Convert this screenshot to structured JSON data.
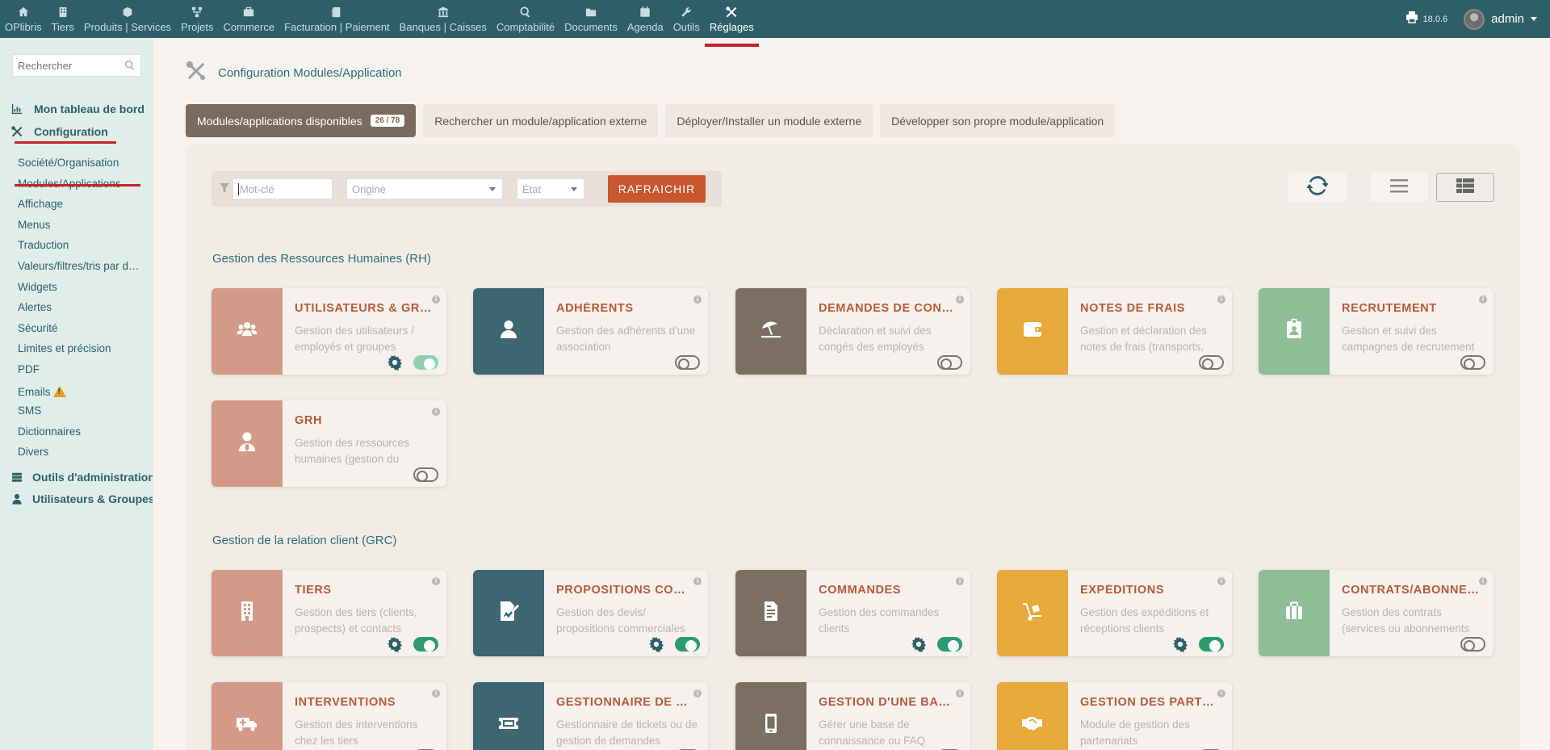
{
  "topnav": {
    "items": [
      {
        "label": "OPlibris",
        "icon": "home-icon"
      },
      {
        "label": "Tiers",
        "icon": "building-icon"
      },
      {
        "label": "Produits | Services",
        "icon": "cube-icon"
      },
      {
        "label": "Projets",
        "icon": "project-icon"
      },
      {
        "label": "Commerce",
        "icon": "briefcase-icon"
      },
      {
        "label": "Facturation | Paiement",
        "icon": "invoice-icon"
      },
      {
        "label": "Banques | Caisses",
        "icon": "bank-icon"
      },
      {
        "label": "Comptabilité",
        "icon": "search-dollar-icon"
      },
      {
        "label": "Documents",
        "icon": "folder-icon"
      },
      {
        "label": "Agenda",
        "icon": "calendar-icon"
      },
      {
        "label": "Outils",
        "icon": "wrench-icon"
      },
      {
        "label": "Réglages",
        "icon": "tools-icon",
        "active": true
      }
    ],
    "version": "18.0.6",
    "user": "admin"
  },
  "sidebar": {
    "search_placeholder": "Rechercher",
    "main_items": [
      {
        "label": "Mon tableau de bord",
        "icon": "chart-icon"
      },
      {
        "label": "Configuration",
        "icon": "tools-icon"
      },
      {
        "label": "Outils d'administration",
        "icon": "server-icon"
      },
      {
        "label": "Utilisateurs & Groupes",
        "icon": "user-icon"
      }
    ],
    "sub_items": [
      "Société/Organisation",
      "Modules/Applications",
      "Affichage",
      "Menus",
      "Traduction",
      "Valeurs/filtres/tris par défaut",
      "Widgets",
      "Alertes",
      "Sécurité",
      "Limites et précision",
      "PDF",
      "Emails",
      "SMS",
      "Dictionnaires",
      "Divers"
    ]
  },
  "page": {
    "title": "Configuration Modules/Application"
  },
  "tabs": [
    {
      "label": "Modules/applications disponibles",
      "badge": "26 / 78"
    },
    {
      "label": "Rechercher un module/application externe"
    },
    {
      "label": "Déployer/Installer un module externe"
    },
    {
      "label": "Développer son propre module/application"
    }
  ],
  "filters": {
    "keyword_placeholder": "Mot-clé",
    "origin_placeholder": "Origine",
    "state_placeholder": "État",
    "refresh_label": "RAFRAICHIR"
  },
  "sections": [
    {
      "title": "Gestion des Ressources Humaines (RH)",
      "cards": [
        {
          "title": "UTILISATEURS & GROUPES",
          "desc": "Gestion des utilisateurs / employés et groupes",
          "color": "#d39a87",
          "icon": "users-icon",
          "enabled": true,
          "light": true,
          "gear": true
        },
        {
          "title": "ADHÉRENTS",
          "desc": "Gestion des adhérents d'une association",
          "color": "#3d6670",
          "icon": "user-icon",
          "enabled": false
        },
        {
          "title": "DEMANDES DE CONGÉS",
          "desc": "Déclaration et suivi des congés des employés",
          "color": "#7b6e62",
          "icon": "umbrella-beach-icon",
          "enabled": false
        },
        {
          "title": "NOTES DE FRAIS",
          "desc": "Gestion et déclaration des notes de frais (transports, repas, ...)",
          "color": "#e6a93a",
          "icon": "wallet-icon",
          "enabled": false
        },
        {
          "title": "RECRUTEMENT",
          "desc": "Gestion et suivi des campagnes de recrutement",
          "color": "#8ebd96",
          "icon": "id-badge-icon",
          "enabled": false
        },
        {
          "title": "GRH",
          "desc": "Gestion des ressources humaines (gestion du département)",
          "color": "#d39a87",
          "icon": "user-tie-icon",
          "enabled": false
        }
      ]
    },
    {
      "title": "Gestion de la relation client (GRC)",
      "cards": [
        {
          "title": "TIERS",
          "desc": "Gestion des tiers (clients, prospects) et contacts",
          "color": "#d39a87",
          "icon": "building-icon",
          "enabled": true,
          "gear": true
        },
        {
          "title": "PROPOSITIONS COMMERCIALES",
          "desc": "Gestion des devis/ propositions commerciales",
          "color": "#3d6670",
          "icon": "file-signature-icon",
          "enabled": true,
          "gear": true
        },
        {
          "title": "COMMANDES",
          "desc": "Gestion des commandes clients",
          "color": "#7b6e62",
          "icon": "file-invoice-icon",
          "enabled": true,
          "gear": true
        },
        {
          "title": "EXPÉDITIONS",
          "desc": "Gestion des expéditions et réceptions clients",
          "color": "#e6a93a",
          "icon": "dolly-icon",
          "enabled": true,
          "gear": true
        },
        {
          "title": "CONTRATS/ABONNEMENTS",
          "desc": "Gestion des contrats (services ou abonnements récurrents)",
          "color": "#8ebd96",
          "icon": "suitcase-icon",
          "enabled": false
        },
        {
          "title": "INTERVENTIONS",
          "desc": "Gestion des interventions chez les tiers",
          "color": "#d39a87",
          "icon": "ambulance-icon",
          "enabled": false
        },
        {
          "title": "GESTIONNAIRE DE TICKETS",
          "desc": "Gestionnaire de tickets ou de gestion de demandes",
          "color": "#3d6670",
          "icon": "ticket-icon",
          "enabled": false
        },
        {
          "title": "GESTION D'UNE BASE DE CONNAISSANCES",
          "desc": "Gérer une base de connaissance ou FAQ",
          "color": "#7b6e62",
          "icon": "mobile-icon",
          "enabled": false
        },
        {
          "title": "GESTION DES PARTENARIATS",
          "desc": "Module de gestion des partenariats",
          "color": "#e6a93a",
          "icon": "handshake-icon",
          "enabled": false
        }
      ]
    }
  ]
}
